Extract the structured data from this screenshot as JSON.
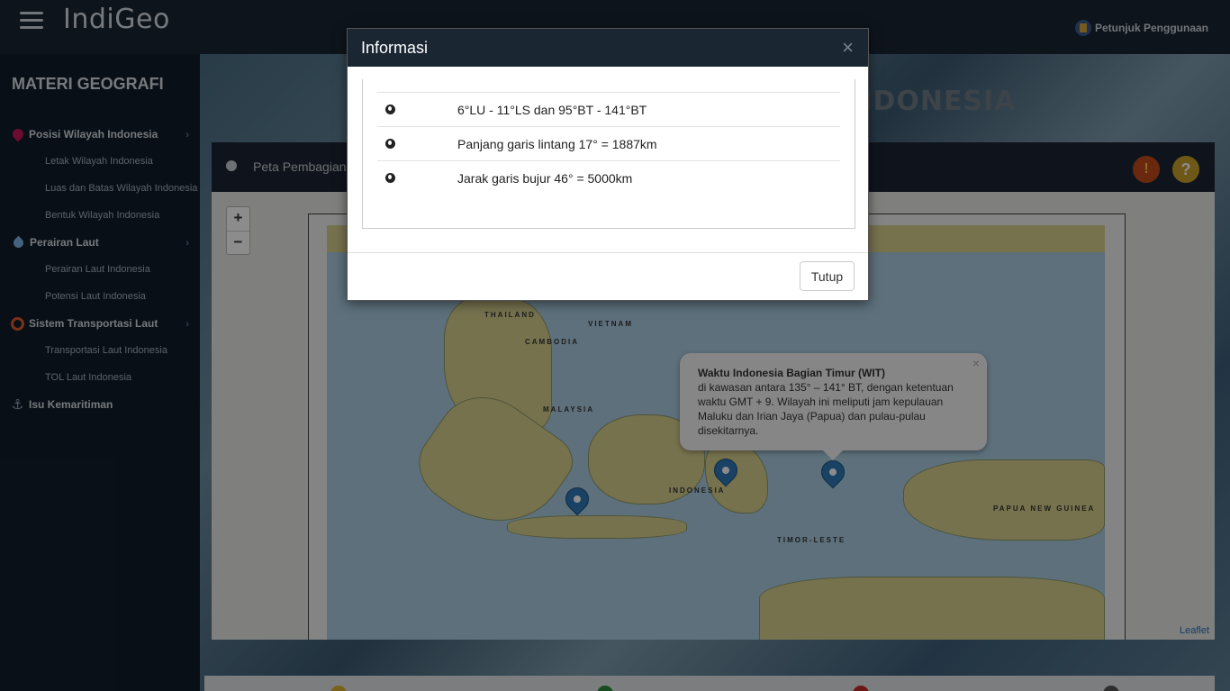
{
  "app": {
    "brand": "IndiGeo",
    "guide_label": "Petunjuk Penggunaan"
  },
  "sidebar": {
    "title": "MATERI GEOGRAFI",
    "groups": [
      {
        "label": "Posisi Wilayah Indonesia",
        "icon": "map-marker-icon",
        "items": [
          "Letak Wilayah Indonesia",
          "Luas dan Batas Wilayah Indonesia",
          "Bentuk Wilayah Indonesia"
        ]
      },
      {
        "label": "Perairan Laut",
        "icon": "water-drop-icon",
        "items": [
          "Perairan Laut Indonesia",
          "Potensi Laut Indonesia"
        ]
      },
      {
        "label": "Sistem Transportasi Laut",
        "icon": "target-icon",
        "items": [
          "Transportasi Laut Indonesia",
          "TOL Laut Indonesia"
        ]
      },
      {
        "label": "Isu Kemaritiman",
        "icon": "anchor-icon",
        "items": []
      }
    ]
  },
  "main": {
    "hero_title": "LETAK ASTRONOMIS INDONESIA",
    "map_title": "Peta Pembagian Waktu Indonesia",
    "zoom_in": "+",
    "zoom_out": "−",
    "attribution": "Leaflet",
    "map_labels": [
      "THAILAND",
      "VIETNAM",
      "CAMBODIA",
      "MALAYSIA",
      "INDONESIA",
      "PAPUA NEW GUINEA",
      "TIMOR-LESTE"
    ]
  },
  "popup": {
    "title": "Waktu Indonesia Bagian Timur (WIT)",
    "text": "di kawasan antara 135° – 141° BT, dengan ketentuan waktu GMT + 9. Wilayah ini meliputi jam kepulauan Maluku dan Irian Jaya (Papua) dan pulau-pulau disekitarnya.",
    "close": "×"
  },
  "modal": {
    "title": "Informasi",
    "close": "×",
    "rows": [
      "6°LU - 11°LS dan 95°BT - 141°BT",
      "Panjang garis lintang 17° = 1887km",
      "Jarak garis bujur 46° = 5000km"
    ],
    "button": "Tutup"
  },
  "colors": {
    "topbar": "#1a2533",
    "sidebar": "#111d2b",
    "pin": "#2f78b8",
    "warn": "#c24a1a",
    "help": "#c9a02a"
  }
}
